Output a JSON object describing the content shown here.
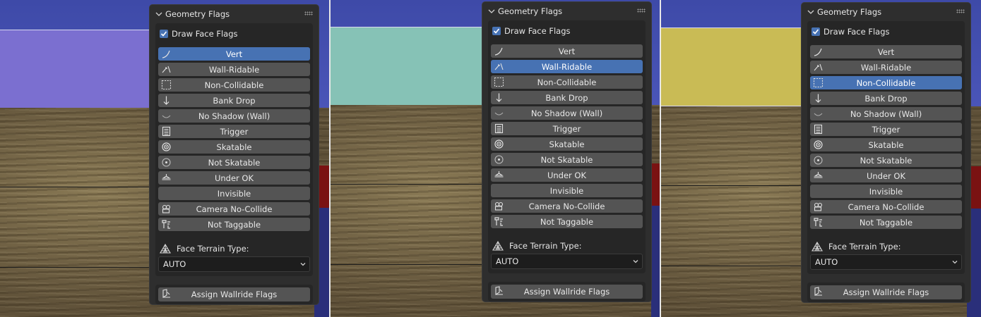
{
  "panel_title": "Geometry Flags",
  "draw_face_flags": {
    "label": "Draw Face Flags",
    "checked": true
  },
  "flags": [
    {
      "label": "Vert",
      "icon": "curve-icon"
    },
    {
      "label": "Wall-Ridable",
      "icon": "wall-ride-icon"
    },
    {
      "label": "Non-Collidable",
      "icon": "dashed-box-icon"
    },
    {
      "label": "Bank Drop",
      "icon": "arrow-down-icon"
    },
    {
      "label": "No Shadow (Wall)",
      "icon": "arc-icon"
    },
    {
      "label": "Trigger",
      "icon": "list-doc-icon"
    },
    {
      "label": "Skatable",
      "icon": "target-icon"
    },
    {
      "label": "Not Skatable",
      "icon": "dot-circle-icon"
    },
    {
      "label": "Under OK",
      "icon": "under-icon"
    },
    {
      "label": "Invisible",
      "icon": ""
    },
    {
      "label": "Camera No-Collide",
      "icon": "camera-icon"
    },
    {
      "label": "Not Taggable",
      "icon": "spray-icon"
    }
  ],
  "terrain": {
    "label": "Face Terrain Type:",
    "value": "AUTO"
  },
  "assign_button": "Assign Wallride Flags",
  "panels": [
    {
      "active_flag": "Vert",
      "highlight_color": "#7b6fd0"
    },
    {
      "active_flag": "Wall-Ridable",
      "highlight_color": "#86c2b6"
    },
    {
      "active_flag": "Non-Collidable",
      "highlight_color": "#c9bb55"
    }
  ],
  "colors": {
    "accent": "#4772b3",
    "button": "#545454",
    "panel": "#2e2e2e"
  }
}
